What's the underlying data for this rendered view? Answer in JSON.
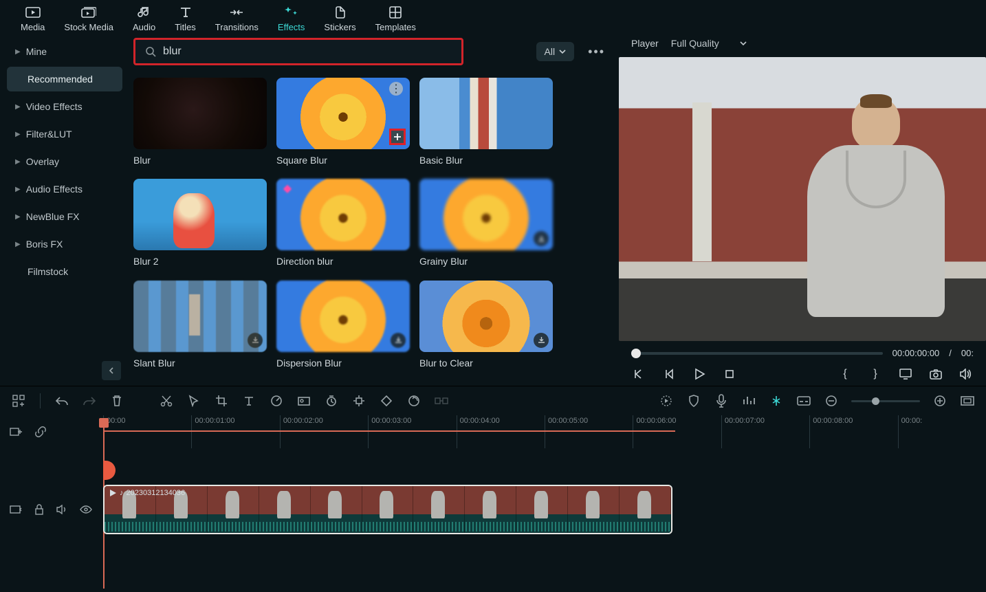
{
  "nav": {
    "tabs": [
      {
        "label": "Media"
      },
      {
        "label": "Stock Media"
      },
      {
        "label": "Audio"
      },
      {
        "label": "Titles"
      },
      {
        "label": "Transitions"
      },
      {
        "label": "Effects"
      },
      {
        "label": "Stickers"
      },
      {
        "label": "Templates"
      }
    ],
    "active": 5
  },
  "sidebar": {
    "items": [
      {
        "label": "Mine",
        "expandable": true
      },
      {
        "label": "Recommended",
        "expandable": false,
        "active": true
      },
      {
        "label": "Video Effects",
        "expandable": true
      },
      {
        "label": "Filter&LUT",
        "expandable": true
      },
      {
        "label": "Overlay",
        "expandable": true
      },
      {
        "label": "Audio Effects",
        "expandable": true
      },
      {
        "label": "NewBlue FX",
        "expandable": true
      },
      {
        "label": "Boris FX",
        "expandable": true
      },
      {
        "label": "Filmstock",
        "expandable": false
      }
    ]
  },
  "search": {
    "value": "blur"
  },
  "filter": {
    "label": "All"
  },
  "effects": [
    {
      "label": "Blur",
      "thumb": "th-dark"
    },
    {
      "label": "Square Blur",
      "thumb": "th-flower",
      "opt": true,
      "highlight": true
    },
    {
      "label": "Basic Blur",
      "thumb": "th-light"
    },
    {
      "label": "Blur 2",
      "thumb": "th-woman"
    },
    {
      "label": "Direction blur",
      "thumb": "th-flower blur1",
      "diamond": true
    },
    {
      "label": "Grainy Blur",
      "thumb": "th-flower blur2",
      "dl": true
    },
    {
      "label": "Slant Blur",
      "thumb": "th-mosaic",
      "dl": true
    },
    {
      "label": "Dispersion Blur",
      "thumb": "th-flower blur1",
      "dl": true
    },
    {
      "label": "Blur to Clear",
      "thumb": "th-flower2 blur3",
      "dl": true
    }
  ],
  "player": {
    "title": "Player",
    "quality": "Full Quality",
    "timecode": "00:00:00:00",
    "sep": "/",
    "duration": "00:"
  },
  "timeline": {
    "ticks": [
      "00:00",
      "00:00:01:00",
      "00:00:02:00",
      "00:00:03:00",
      "00:00:04:00",
      "00:00:05:00",
      "00:00:06:00",
      "00:00:07:00",
      "00:00:08:00",
      "00:00:"
    ],
    "clip_name": "20230312134036"
  }
}
